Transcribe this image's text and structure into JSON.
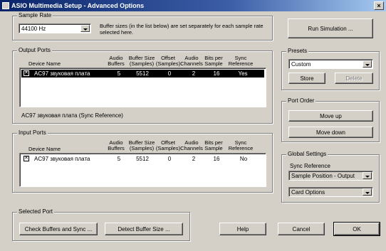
{
  "window": {
    "title": "ASIO Multimedia Setup - Advanced Options",
    "close_glyph": "×"
  },
  "sample_rate": {
    "group_label": "Sample Rate",
    "selected": "44100 Hz",
    "note": "Buffer sizes (in the list below) are set separately for each sample rate selected here."
  },
  "run_simulation_label": "Run Simulation ...",
  "columns": [
    "Device Name",
    "Audio\nBuffers",
    "Buffer Size\n(Samples)",
    "Offset\n(Samples)",
    "Audio\nChannels",
    "Bits per\nSample",
    "Sync\nReference"
  ],
  "output_ports": {
    "group_label": "Output Ports",
    "rows": [
      {
        "checked": true,
        "device": "AC97 звуковая плата",
        "buffers": "5",
        "size": "5512",
        "offset": "0",
        "channels": "2",
        "bits": "16",
        "sync": "Yes",
        "selected": true
      }
    ],
    "sync_reference_text": "AC97 звуковая плата (Sync Reference)"
  },
  "input_ports": {
    "group_label": "Input Ports",
    "rows": [
      {
        "checked": true,
        "device": "AC97 звуковая плата",
        "buffers": "5",
        "size": "5512",
        "offset": "0",
        "channels": "2",
        "bits": "16",
        "sync": "No",
        "selected": false
      }
    ]
  },
  "presets": {
    "group_label": "Presets",
    "selected": "Custom",
    "store_label": "Store",
    "delete_label": "Delete"
  },
  "port_order": {
    "group_label": "Port Order",
    "move_up_label": "Move up",
    "move_down_label": "Move down"
  },
  "global_settings": {
    "group_label": "Global Settings",
    "sync_reference_label": "Sync Reference",
    "sync_reference_value": "Sample Position - Output",
    "card_options_value": "Card Options"
  },
  "selected_port": {
    "group_label": "Selected Port",
    "check_buffers_label": "Check Buffers and Sync ...",
    "detect_buffer_label": "Detect Buffer Size ..."
  },
  "buttons": {
    "help": "Help",
    "cancel": "Cancel",
    "ok": "OK"
  }
}
